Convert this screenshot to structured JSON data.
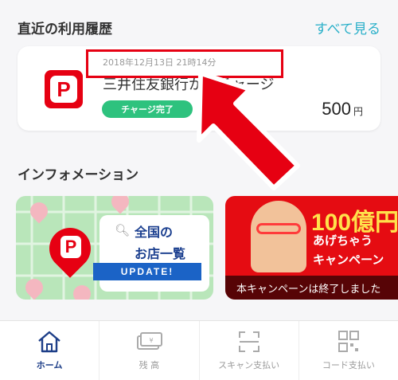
{
  "history": {
    "title": "直近の利用履歴",
    "see_all": "すべて見る",
    "transaction": {
      "date": "2018年12月13日 21時14分",
      "title": "三井住友銀行からチャージ",
      "status": "チャージ完了",
      "amount": "500",
      "currency": "円"
    }
  },
  "info": {
    "title": "インフォメーション",
    "banner1": {
      "line1": "全国の",
      "line2": "お店一覧",
      "tag": "UPDATE!"
    },
    "banner2": {
      "headline": "100億円",
      "line1": "あげちゃう",
      "line2": "キャンペーン",
      "ended": "本キャンペーンは終了しました"
    }
  },
  "nav": {
    "home": "ホーム",
    "balance": "残 高",
    "scan": "スキャン支払い",
    "code": "コード支払い"
  },
  "colors": {
    "brand": "#e60012",
    "accent": "#2bb0c9",
    "success": "#2ec27e",
    "nav_active": "#1d3e88"
  },
  "icons": [
    "paypay-logo",
    "home-icon",
    "balance-icon",
    "scan-icon",
    "qr-code-icon",
    "search-icon",
    "arrow-annotation"
  ]
}
